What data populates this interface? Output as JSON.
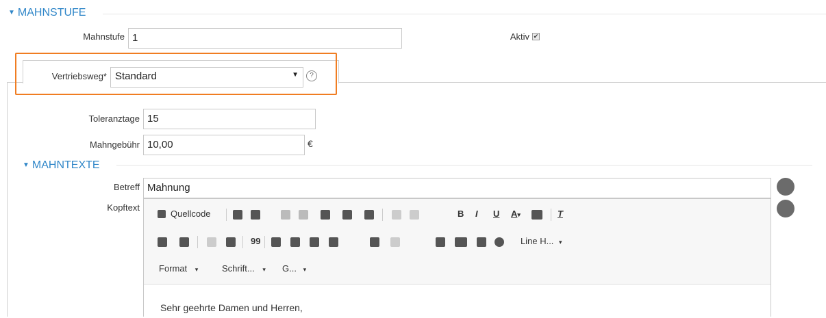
{
  "sections": {
    "mahnstufe_title": "MAHNSTUFE",
    "mahntexte_title": "MAHNTEXTE"
  },
  "fields": {
    "mahnstufe_label": "Mahnstufe",
    "mahnstufe_value": "1",
    "aktiv_label": "Aktiv",
    "aktiv_checked": true,
    "vertriebsweg_label": "Vertriebsweg*",
    "vertriebsweg_value": "Standard",
    "toleranztage_label": "Toleranztage",
    "toleranztage_value": "15",
    "mahngebuehr_label": "Mahngebühr",
    "mahngebuehr_value": "10,00",
    "currency": "€",
    "betreff_label": "Betreff",
    "betreff_value": "Mahnung",
    "kopftext_label": "Kopftext"
  },
  "editor": {
    "source_label": "Quellcode",
    "line_height_label": "Line H...",
    "format_label": "Format",
    "font_label": "Schrift...",
    "size_label": "G...",
    "bold": "B",
    "italic": "I",
    "underline": "U",
    "font_color": "A",
    "content_text": "Sehr geehrte Damen und Herren,"
  },
  "colors": {
    "accent_blue": "#2f86c8",
    "highlight_orange": "#f07d22"
  }
}
